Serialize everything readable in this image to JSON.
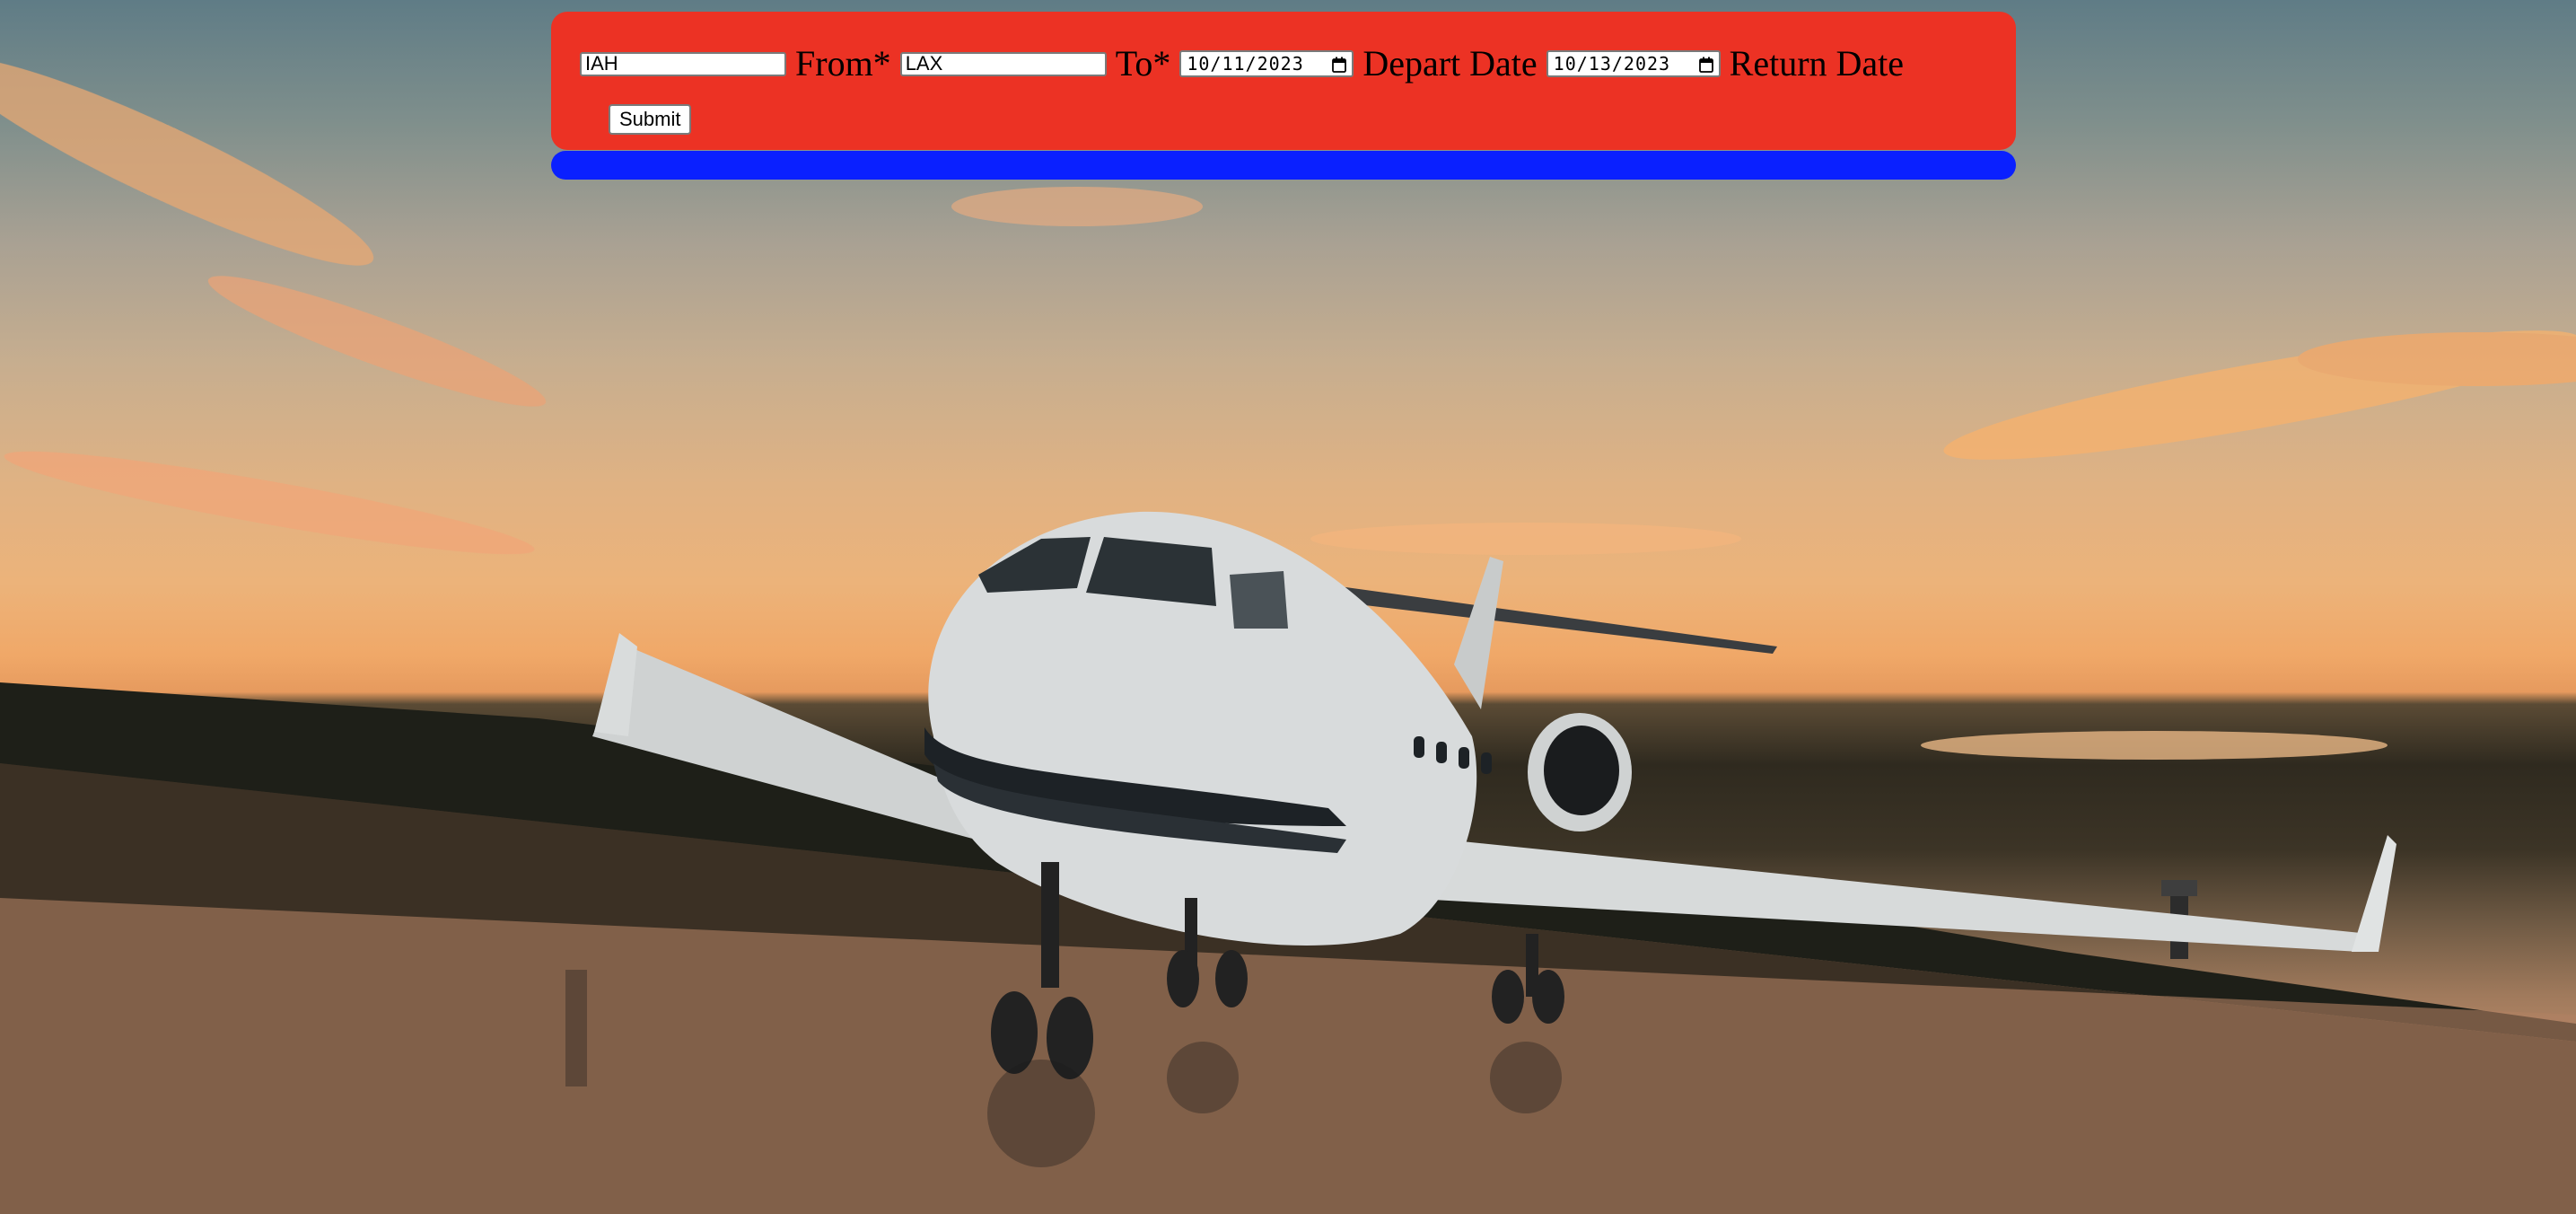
{
  "form": {
    "from": {
      "value": "IAH",
      "label": "From*"
    },
    "to": {
      "value": "LAX",
      "label": "To*"
    },
    "depart": {
      "value": "10/11/2023",
      "label": "Depart Date"
    },
    "return": {
      "value": "10/13/2023",
      "label": "Return Date"
    },
    "submit_label": "Submit"
  },
  "colors": {
    "banner": "#ec3224",
    "bar": "#0a20ff"
  },
  "icons": {
    "date_picker": "calendar-icon"
  }
}
